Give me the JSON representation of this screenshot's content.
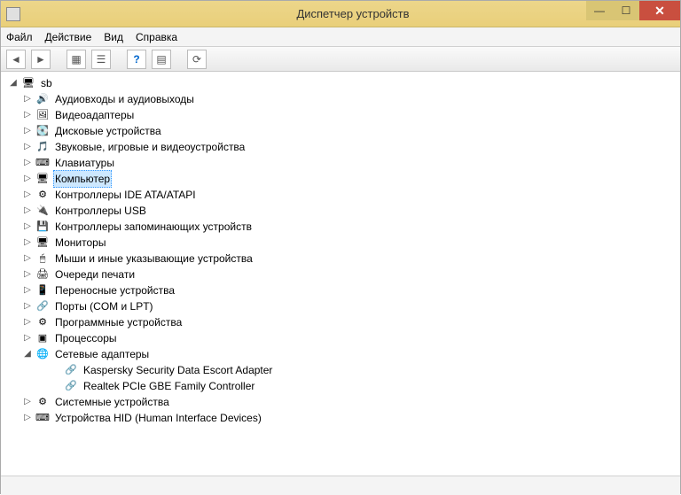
{
  "title": "Диспетчер устройств",
  "menu": {
    "file": "Файл",
    "action": "Действие",
    "view": "Вид",
    "help": "Справка"
  },
  "tree": {
    "root": {
      "label": "sb",
      "expanded": true,
      "icon": "computer"
    },
    "items": [
      {
        "label": "Аудиовходы и аудиовыходы",
        "expanded": false,
        "has_children": true,
        "icon": "audio"
      },
      {
        "label": "Видеоадаптеры",
        "expanded": false,
        "has_children": true,
        "icon": "video"
      },
      {
        "label": "Дисковые устройства",
        "expanded": false,
        "has_children": true,
        "icon": "disk"
      },
      {
        "label": "Звуковые, игровые и видеоустройства",
        "expanded": false,
        "has_children": true,
        "icon": "sound"
      },
      {
        "label": "Клавиатуры",
        "expanded": false,
        "has_children": true,
        "icon": "keyboard"
      },
      {
        "label": "Компьютер",
        "expanded": false,
        "has_children": true,
        "icon": "computer-node",
        "selected": true
      },
      {
        "label": "Контроллеры IDE ATA/ATAPI",
        "expanded": false,
        "has_children": true,
        "icon": "ide"
      },
      {
        "label": "Контроллеры USB",
        "expanded": false,
        "has_children": true,
        "icon": "usb"
      },
      {
        "label": "Контроллеры запоминающих устройств",
        "expanded": false,
        "has_children": true,
        "icon": "storage"
      },
      {
        "label": "Мониторы",
        "expanded": false,
        "has_children": true,
        "icon": "monitor"
      },
      {
        "label": "Мыши и иные указывающие устройства",
        "expanded": false,
        "has_children": true,
        "icon": "mouse"
      },
      {
        "label": "Очереди печати",
        "expanded": false,
        "has_children": true,
        "icon": "print"
      },
      {
        "label": "Переносные устройства",
        "expanded": false,
        "has_children": true,
        "icon": "portable"
      },
      {
        "label": "Порты (COM и LPT)",
        "expanded": false,
        "has_children": true,
        "icon": "port"
      },
      {
        "label": "Программные устройства",
        "expanded": false,
        "has_children": true,
        "icon": "software"
      },
      {
        "label": "Процессоры",
        "expanded": false,
        "has_children": true,
        "icon": "cpu"
      },
      {
        "label": "Сетевые адаптеры",
        "expanded": true,
        "has_children": true,
        "icon": "network",
        "children": [
          {
            "label": "Kaspersky Security Data Escort Adapter",
            "icon": "net-adapter"
          },
          {
            "label": "Realtek PCIe GBE Family Controller",
            "icon": "net-adapter"
          }
        ]
      },
      {
        "label": "Системные устройства",
        "expanded": false,
        "has_children": true,
        "icon": "system"
      },
      {
        "label": "Устройства HID (Human Interface Devices)",
        "expanded": false,
        "has_children": true,
        "icon": "hid"
      }
    ]
  },
  "icons": {
    "computer": "🖥",
    "audio": "🔊",
    "video": "🖼",
    "disk": "💽",
    "sound": "🎵",
    "keyboard": "⌨",
    "computer-node": "🖥",
    "ide": "⚙",
    "usb": "🔌",
    "storage": "💾",
    "monitor": "🖥",
    "mouse": "🖱",
    "print": "🖨",
    "portable": "📱",
    "port": "🔗",
    "software": "⚙",
    "cpu": "▣",
    "network": "🌐",
    "net-adapter": "🔗",
    "system": "⚙",
    "hid": "⌨"
  }
}
